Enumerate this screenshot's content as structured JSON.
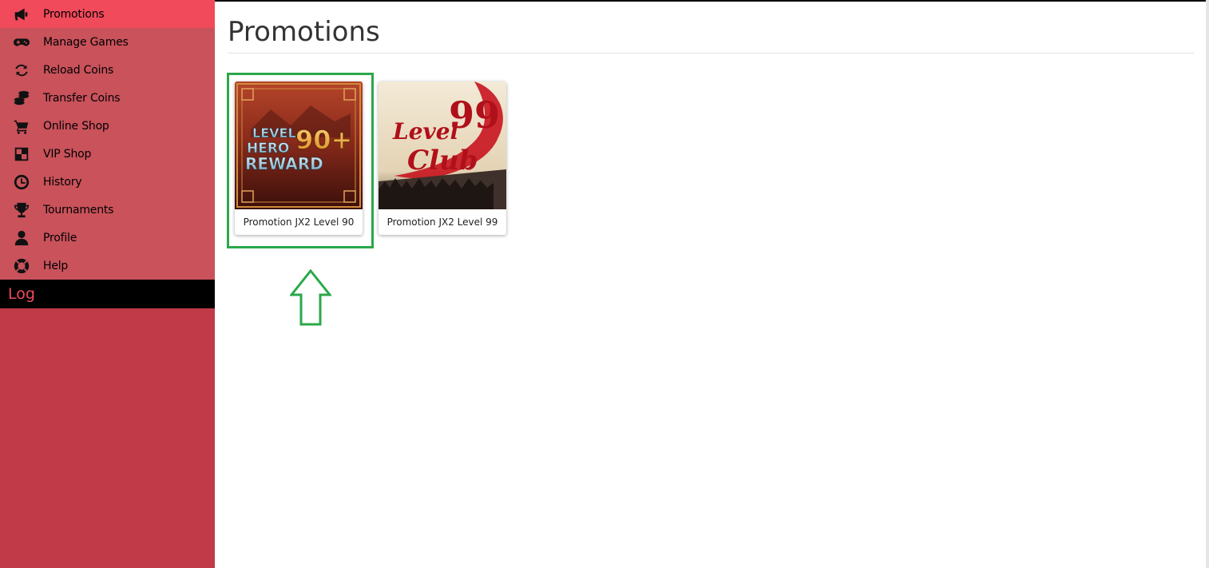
{
  "sidebar": {
    "items": [
      {
        "label": "Promotions",
        "icon": "megaphone-icon",
        "active": true
      },
      {
        "label": "Manage Games",
        "icon": "gamepad-icon"
      },
      {
        "label": "Reload Coins",
        "icon": "refresh-icon"
      },
      {
        "label": "Transfer Coins",
        "icon": "coins-icon"
      },
      {
        "label": "Online Shop",
        "icon": "cart-icon"
      },
      {
        "label": "VIP Shop",
        "icon": "checker-icon"
      },
      {
        "label": "History",
        "icon": "clock-icon"
      },
      {
        "label": "Tournaments",
        "icon": "trophy-icon"
      },
      {
        "label": "Profile",
        "icon": "user-icon"
      },
      {
        "label": "Help",
        "icon": "lifebuoy-icon"
      }
    ],
    "log_label": "Log"
  },
  "main": {
    "title": "Promotions",
    "cards": [
      {
        "name": "Promotion JX2 Level 90",
        "image_text": [
          "LEVEL",
          "HERO",
          "90+",
          "REWARD"
        ]
      },
      {
        "name": "Promotion JX2 Level 99",
        "image_text": [
          "Level",
          "99",
          "Club"
        ]
      }
    ]
  },
  "colors": {
    "sidebar_bg": "#c13a47",
    "menu_bg": "#c9525b",
    "active_bg": "#f14a5b",
    "highlight": "#2aa84a"
  }
}
